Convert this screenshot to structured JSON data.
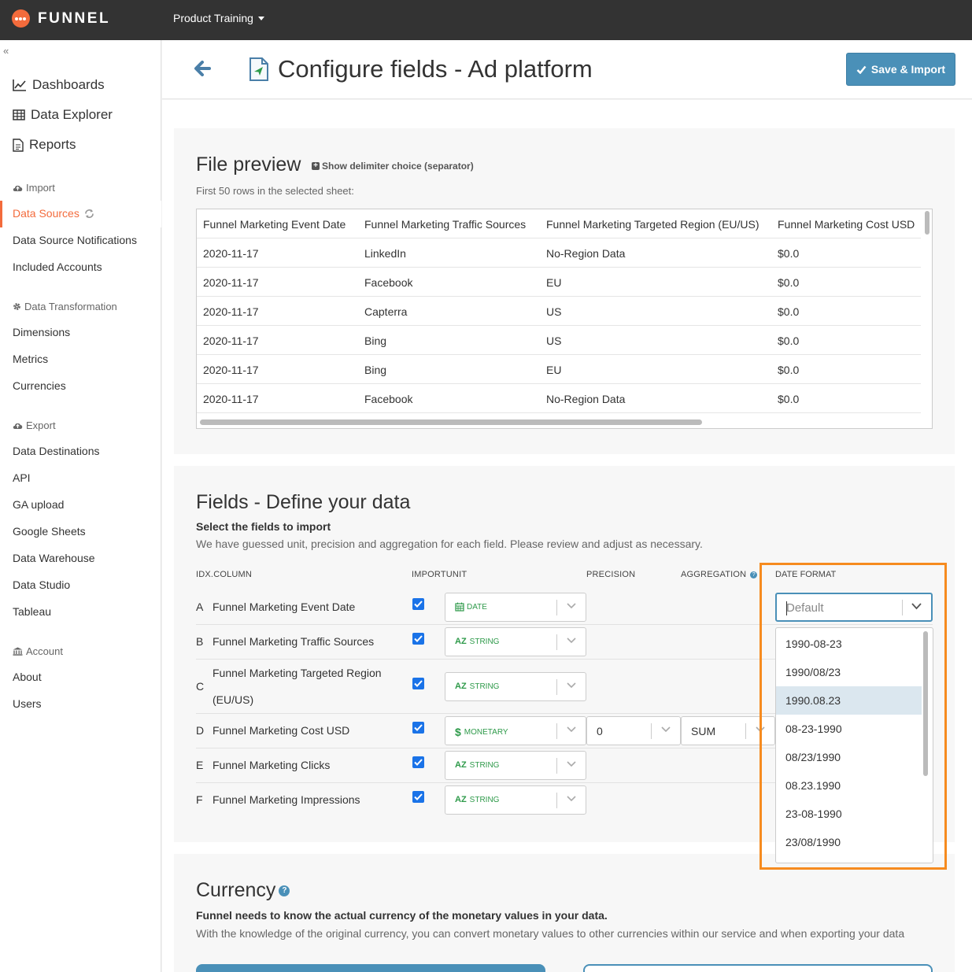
{
  "topbar": {
    "brand": "FUNNEL",
    "workspace": "Product Training"
  },
  "sidebar": {
    "main_items": [
      {
        "label": "Dashboards",
        "icon": "line-chart-icon"
      },
      {
        "label": "Data Explorer",
        "icon": "table-icon"
      },
      {
        "label": "Reports",
        "icon": "document-icon"
      }
    ],
    "import_header": "Import",
    "import_items": [
      "Data Sources",
      "Data Source Notifications",
      "Included Accounts"
    ],
    "transformation_header": "Data Transformation",
    "transformation_items": [
      "Dimensions",
      "Metrics",
      "Currencies"
    ],
    "export_header": "Export",
    "export_items": [
      "Data Destinations",
      "API",
      "GA upload",
      "Google Sheets",
      "Data Warehouse",
      "Data Studio",
      "Tableau"
    ],
    "account_header": "Account",
    "account_items": [
      "About",
      "Users"
    ],
    "active_item": "Data Sources"
  },
  "header": {
    "title": "Configure fields - Ad platform",
    "save_label": "Save & Import"
  },
  "file_preview": {
    "title": "File preview",
    "delimiter_link": "Show delimiter choice (separator)",
    "subtitle": "First 50 rows in the selected sheet:",
    "columns": [
      "Funnel Marketing Event Date",
      "Funnel Marketing Traffic Sources",
      "Funnel Marketing Targeted Region (EU/US)",
      "Funnel Marketing Cost USD"
    ],
    "rows": [
      [
        "2020-11-17",
        "LinkedIn",
        "No-Region Data",
        "$0.0"
      ],
      [
        "2020-11-17",
        "Facebook",
        "EU",
        "$0.0"
      ],
      [
        "2020-11-17",
        "Capterra",
        "US",
        "$0.0"
      ],
      [
        "2020-11-17",
        "Bing",
        "US",
        "$0.0"
      ],
      [
        "2020-11-17",
        "Bing",
        "EU",
        "$0.0"
      ],
      [
        "2020-11-17",
        "Facebook",
        "No-Region Data",
        "$0.0"
      ]
    ]
  },
  "fields": {
    "title": "Fields - Define your data",
    "subtitle": "Select the fields to import",
    "description": "We have guessed unit, precision and aggregation for each field. Please review and adjust as necessary.",
    "headers": {
      "idx_column": "IDX.COLUMN",
      "import_unit": "IMPORTUNIT",
      "precision": "PRECISION",
      "aggregation": "AGGREGATION",
      "date_format": "DATE FORMAT"
    },
    "rows": [
      {
        "idx": "A",
        "name": "Funnel Marketing Event Date",
        "checked": true,
        "unit": "DATE",
        "unit_icon": "calendar-icon"
      },
      {
        "idx": "B",
        "name": "Funnel Marketing Traffic Sources",
        "checked": true,
        "unit": "STRING",
        "unit_prefix": "AZ"
      },
      {
        "idx": "C",
        "name_line1": "Funnel Marketing Targeted Region",
        "name_line2": "(EU/US)",
        "checked": true,
        "unit": "STRING",
        "unit_prefix": "AZ"
      },
      {
        "idx": "D",
        "name": "Funnel Marketing Cost USD",
        "checked": true,
        "unit": "MONETARY",
        "unit_prefix": "$",
        "precision": "0",
        "aggregation": "SUM"
      },
      {
        "idx": "E",
        "name": "Funnel Marketing Clicks",
        "checked": true,
        "unit": "STRING",
        "unit_prefix": "AZ"
      },
      {
        "idx": "F",
        "name": "Funnel Marketing Impressions",
        "checked": true,
        "unit": "STRING",
        "unit_prefix": "AZ"
      }
    ]
  },
  "date_format": {
    "placeholder": "Default",
    "options": [
      "1990-08-23",
      "1990/08/23",
      "1990.08.23",
      "08-23-1990",
      "08/23/1990",
      "08.23.1990",
      "23-08-1990",
      "23/08/1990"
    ],
    "highlighted": "1990.08.23"
  },
  "currency": {
    "title": "Currency",
    "subtitle": "Funnel needs to know the actual currency of the monetary values in your data.",
    "description": "With the knowledge of the original currency, you can convert monetary values to other currencies within our service and when exporting your data"
  },
  "colors": {
    "brand_orange": "#f36b3c",
    "accent_blue": "#4a90b8",
    "unit_green": "#2e9a4a",
    "highlight_orange": "#f68b1f",
    "topbar": "#333333"
  }
}
